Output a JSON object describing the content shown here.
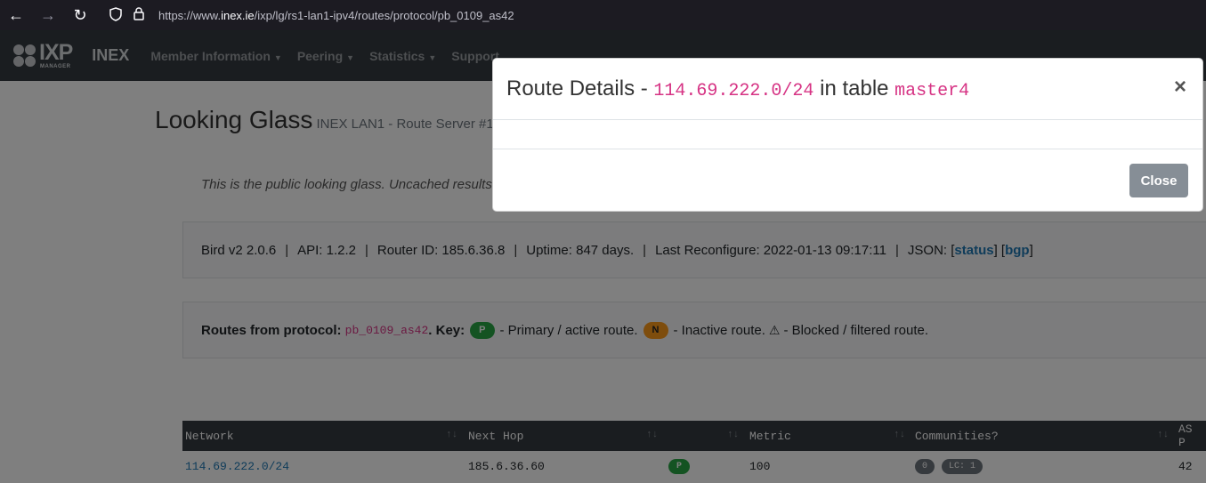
{
  "browser": {
    "url_prefix": "https://www.",
    "url_host": "inex.ie",
    "url_path": "/ixp/lg/rs1-lan1-ipv4/routes/protocol/pb_0109_as42"
  },
  "navbar": {
    "logo_text": "IXP",
    "logo_sub": "MANAGER",
    "brand": "INEX",
    "items": [
      {
        "label": "Member Information"
      },
      {
        "label": "Peering"
      },
      {
        "label": "Statistics"
      },
      {
        "label": "Support"
      }
    ]
  },
  "page": {
    "title": "Looking Glass",
    "subtitle": "INEX LAN1 - Route Server #1 -",
    "intro": "This is the public looking glass. Uncached results"
  },
  "bird_info": {
    "version": "Bird v2 2.0.6",
    "api": "API: 1.2.2",
    "router_id": "Router ID: 185.6.36.8",
    "uptime": "Uptime: 847 days.",
    "last_reconfigure": "Last Reconfigure: 2022-01-13 09:17:11",
    "json_label": "JSON: [",
    "status_link": "status",
    "mid": "] [",
    "bgp_link": "bgp",
    "end": "]"
  },
  "routes_info": {
    "label": "Routes from protocol:",
    "protocol": "pb_0109_as42",
    "key_label": ". Key:",
    "badge_p": "P",
    "primary_text": "- Primary / active route.",
    "badge_n": "N",
    "inactive_text": "- Inactive route.",
    "blocked_text": "- Blocked / filtered route."
  },
  "table": {
    "headers": [
      "Network",
      "Next Hop",
      "",
      "Metric",
      "Communities?",
      "AS P"
    ],
    "rows": [
      {
        "network": "114.69.222.0/24",
        "next_hop": "185.6.36.60",
        "badge": "P",
        "metric": "100",
        "comm1": "0",
        "comm2": "LC: 1",
        "as": "42"
      }
    ]
  },
  "modal": {
    "title_prefix": "Route Details - ",
    "prefix": "114.69.222.0/24",
    "title_mid": " in table ",
    "table_name": "master4",
    "close_label": "Close"
  }
}
